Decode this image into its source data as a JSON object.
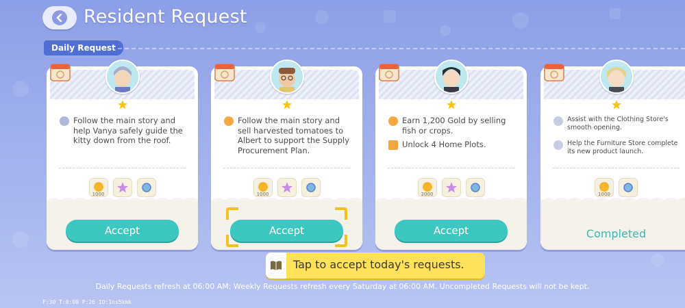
{
  "header": {
    "title": "Resident Request",
    "back_icon": "chevron-left-icon"
  },
  "section": {
    "label": "Daily Request"
  },
  "cards": [
    {
      "avatar": "resident-avatar-gray-hair",
      "tasks": [
        {
          "icon": "resident-icon",
          "text": "Follow the main story and help Vanya safely guide the kitty down from the roof."
        }
      ],
      "rewards": [
        {
          "icon": "gold-coin-icon",
          "qty": "1000"
        },
        {
          "icon": "star-shard-icon",
          "qty": ""
        },
        {
          "icon": "badge-icon",
          "qty": ""
        }
      ],
      "button": "Accept"
    },
    {
      "avatar": "resident-avatar-albert",
      "tasks": [
        {
          "icon": "sun-icon",
          "text": "Follow the main story and sell harvested tomatoes to Albert to support the Supply Procurement Plan."
        }
      ],
      "rewards": [
        {
          "icon": "gold-coin-icon",
          "qty": "1000"
        },
        {
          "icon": "star-shard-icon",
          "qty": ""
        },
        {
          "icon": "badge-icon",
          "qty": ""
        }
      ],
      "button": "Accept"
    },
    {
      "avatar": "resident-avatar-dark-hair",
      "tasks": [
        {
          "icon": "sun-icon",
          "text": "Earn 1,200 Gold by selling fish or crops."
        },
        {
          "icon": "home-icon",
          "text": "Unlock 4 Home Plots."
        }
      ],
      "rewards": [
        {
          "icon": "gold-coin-icon",
          "qty": "2000"
        },
        {
          "icon": "star-shard-icon",
          "qty": ""
        },
        {
          "icon": "badge-icon",
          "qty": ""
        }
      ],
      "button": "Accept"
    },
    {
      "avatar": "resident-avatar-blonde",
      "tasks": [
        {
          "icon": "resident-icon",
          "text": "Assist with the Clothing Store's smooth opening."
        },
        {
          "icon": "resident-icon",
          "text": "Help the Furniture Store complete its new product launch."
        }
      ],
      "rewards": [
        {
          "icon": "gold-coin-icon",
          "qty": "1000"
        },
        {
          "icon": "badge-icon",
          "qty": ""
        }
      ],
      "button": "Completed"
    }
  ],
  "tip": {
    "text": "Tap to accept today's requests.",
    "icon": "book-icon"
  },
  "footer": {
    "text": "Daily Requests refresh at 06:00 AM; Weekly Requests refresh every Saturday at 06:00 AM. Uncompleted Requests will not be kept."
  },
  "debug": {
    "text": "F:30  T:0:00  P:26  ID:1ns5kmk"
  },
  "colors": {
    "accept": "#3cc8c0",
    "completed": "#3ab7b0",
    "tip_bg": "#ffe15c",
    "tag_bg": "#4f6fd2"
  }
}
